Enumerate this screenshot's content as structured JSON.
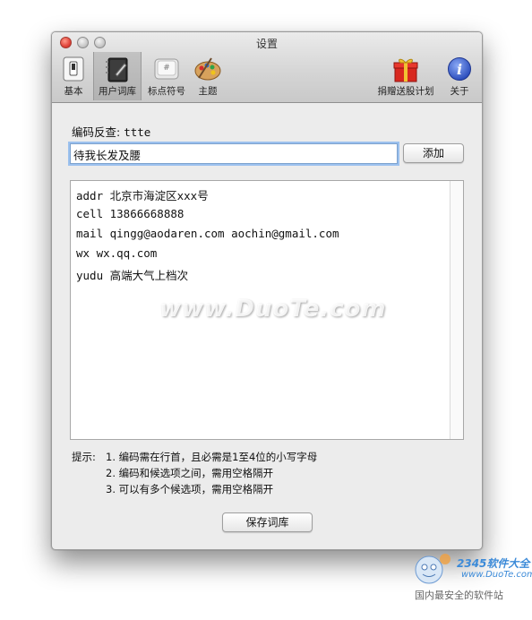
{
  "window": {
    "title": "设置"
  },
  "toolbar": {
    "items": [
      {
        "label": "基本",
        "icon": "switch-icon"
      },
      {
        "label": "用户词库",
        "icon": "notebook-icon",
        "selected": true
      },
      {
        "label": "标点符号",
        "icon": "keyboard-key-icon"
      },
      {
        "label": "主题",
        "icon": "palette-icon"
      },
      {
        "label": "捐赠送股计划",
        "icon": "gift-icon"
      },
      {
        "label": "关于",
        "icon": "info-icon"
      }
    ]
  },
  "main": {
    "code_lookup_label": "编码反查:",
    "code_lookup_value": "ttte",
    "input_value": "待我长发及腰",
    "add_label": "添加",
    "entries": [
      "addr 北京市海淀区xxx号",
      "cell 13866668888",
      "mail qingg@aodaren.com aochin@gmail.com",
      "wx wx.qq.com",
      "yudu 高端大气上档次"
    ],
    "tips_label": "提示:",
    "tips": [
      "1. 编码需在行首，且必需是1至4位的小写字母",
      "2. 编码和候选项之间，需用空格隔开",
      "3. 可以有多个候选项，需用空格隔开"
    ],
    "save_label": "保存词库"
  },
  "watermark": {
    "text": "www.DuoTe.com"
  },
  "site_logo": {
    "line1": "2345软件大全",
    "line2": "www.DuoTe.com",
    "line3": "国内最安全的软件站"
  },
  "colors": {
    "focus_ring": "#9cc1ee",
    "close_button": "#e0443a",
    "gift_red": "#d8281f",
    "info_blue": "#3a5fcf"
  }
}
